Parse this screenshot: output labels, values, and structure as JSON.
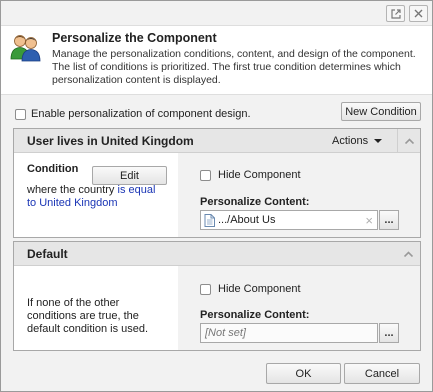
{
  "header": {
    "title": "Personalize the Component",
    "description": "Manage the personalization conditions, content, and design of the component. The list of conditions is prioritized. The first true condition determines which personalization content is displayed."
  },
  "titlebar": {
    "popout_icon": "popout-icon",
    "close_icon": "close-icon"
  },
  "enable_label": "Enable personalization of component design.",
  "new_condition_label": "New Condition",
  "conditions": [
    {
      "title": "User lives in United Kingdom",
      "actions_label": "Actions",
      "condition_label": "Condition",
      "edit_label": "Edit",
      "cond_prefix": "where the country ",
      "cond_link": "is equal to United Kingdom",
      "hide_label": "Hide Component",
      "content_label": "Personalize Content:",
      "content_value": ".../About Us"
    },
    {
      "title": "Default",
      "description": "If none of the other conditions are true, the default condition is used.",
      "hide_label": "Hide Component",
      "content_label": "Personalize Content:",
      "content_placeholder": "[Not set]"
    }
  ],
  "browse_label": "...",
  "clear_glyph": "×",
  "footer": {
    "ok_label": "OK",
    "cancel_label": "Cancel"
  },
  "colors": {
    "link": "#1a35b5",
    "panel_header": "#e6e6e6"
  }
}
